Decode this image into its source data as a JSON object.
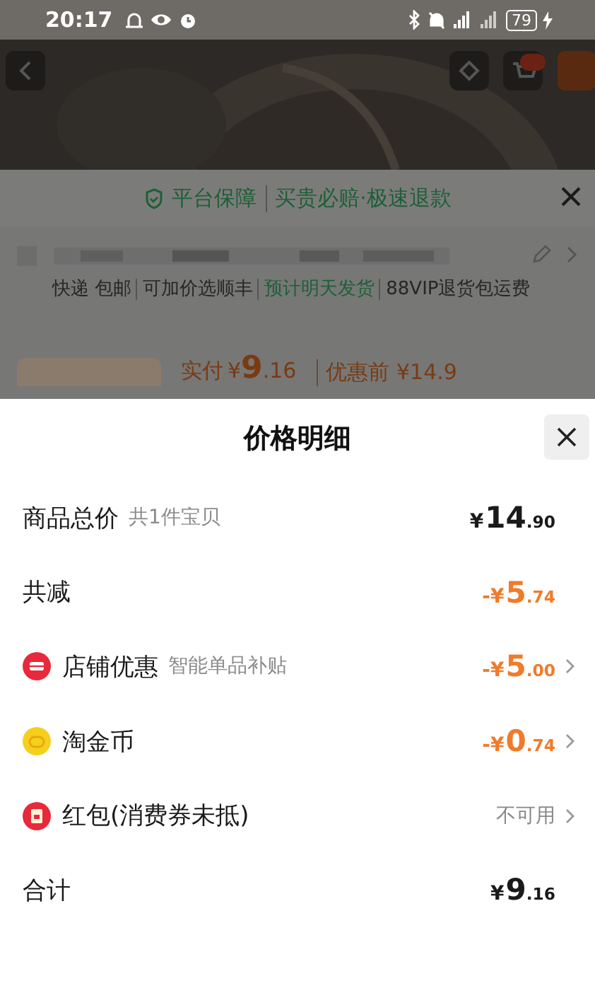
{
  "status_bar": {
    "time": "20:17",
    "battery": "79"
  },
  "background_page": {
    "guarantee": [
      "平台保障",
      "买贵必赔·极速退款"
    ],
    "shipping_tags": [
      {
        "text": "快递 包邮",
        "kind": "plain"
      },
      {
        "text": "可加价选顺丰",
        "kind": "plain"
      },
      {
        "text": "预计明天发货",
        "kind": "highlight"
      },
      {
        "text": "88VIP退货包运费",
        "kind": "plain"
      }
    ],
    "paid_label": "实付",
    "paid_amount": {
      "currency": "¥",
      "whole": "9",
      "fraction": ".16"
    },
    "original_price": "优惠前 ¥14.9"
  },
  "sheet": {
    "title": "价格明细",
    "rows": [
      {
        "kind": "subtotal",
        "label": "商品总价",
        "note": "共1件宝贝",
        "amount": {
          "currency": "¥",
          "whole": "14",
          "fraction": ".90"
        },
        "arrow": false
      },
      {
        "kind": "reduction",
        "label": "共减",
        "amount": {
          "sign": "-",
          "currency": "¥",
          "whole": "5",
          "fraction": ".74"
        },
        "arrow": false
      },
      {
        "kind": "shop",
        "label": "店铺优惠",
        "note": "智能单品补贴",
        "amount": {
          "sign": "-",
          "currency": "¥",
          "whole": "5",
          "fraction": ".00"
        },
        "arrow": true
      },
      {
        "kind": "coin",
        "label": "淘金币",
        "amount": {
          "sign": "-",
          "currency": "¥",
          "whole": "0",
          "fraction": ".74"
        },
        "arrow": true
      },
      {
        "kind": "envelope",
        "label": "红包(消费券未抵)",
        "status": "不可用",
        "arrow": true
      },
      {
        "kind": "total",
        "label": "合计",
        "amount": {
          "currency": "¥",
          "whole": "9",
          "fraction": ".16"
        },
        "arrow": false
      }
    ]
  }
}
